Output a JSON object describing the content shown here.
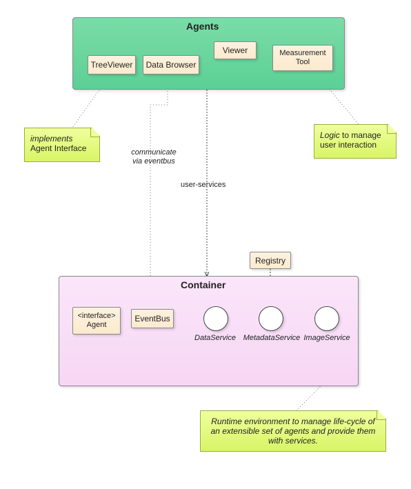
{
  "agents": {
    "title": "Agents",
    "items": {
      "treeviewer": "TreeViewer",
      "databrowser": "Data Browser",
      "viewer": "Viewer",
      "measurement": "Measurement\nTool"
    }
  },
  "notes": {
    "impl1": "implements",
    "impl2": "Agent Interface",
    "eventbus1": "communicate",
    "eventbus2": "via eventbus",
    "logic1": "Logic",
    "logic2": " to manage",
    "logic3": "user interaction",
    "runtime": "Runtime environment to manage life-cycle of an extensible set of agents and provide them with services."
  },
  "labels": {
    "userservices": "user-services"
  },
  "container": {
    "title": "Container",
    "registry": "Registry",
    "agent1": "<interface>",
    "agent2": "Agent",
    "eventbus": "EventBus",
    "services": {
      "data": "DataService",
      "meta": "MetadataService",
      "image": "ImageService"
    }
  }
}
